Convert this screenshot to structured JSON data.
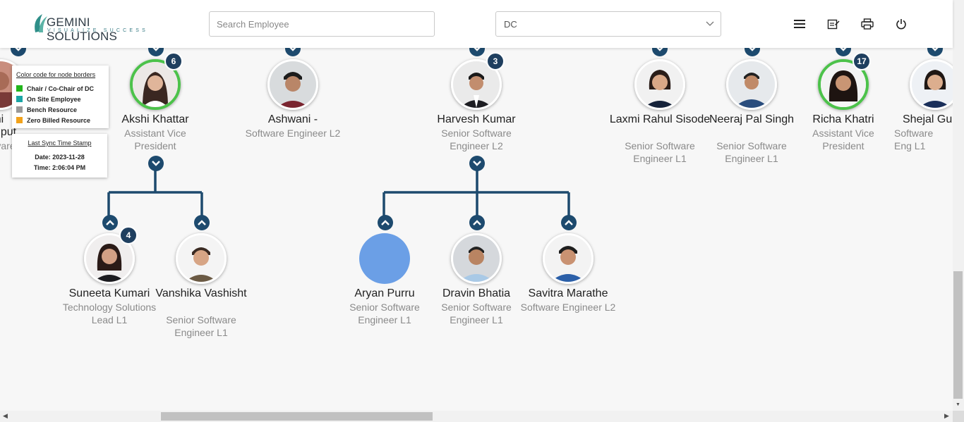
{
  "header": {
    "logo_name": "GEMINI SOLUTIONS",
    "logo_tagline": "VISUALIZE SUCCESS",
    "search_placeholder": "Search Employee",
    "select_value": "DC",
    "icons": [
      "menu-icon",
      "notes-icon",
      "print-icon",
      "power-icon"
    ]
  },
  "legend": {
    "title": "Color code for node borders",
    "items": [
      {
        "label": "Chair / Co-Chair of DC",
        "color": "#22b51c"
      },
      {
        "label": "On Site Employee",
        "color": "#1aa5a5"
      },
      {
        "label": "Bench Resource",
        "color": "#999999"
      },
      {
        "label": "Zero Billed Resource",
        "color": "#f2a21b"
      }
    ]
  },
  "sync": {
    "title": "Last Sync Time Stamp",
    "date": "Date: 2023-11-28",
    "time": "Time: 2:06:04 PM"
  },
  "partial_node": {
    "name_line1": "khi",
    "name_line2": "Rajput",
    "role": "vare"
  },
  "top_row": [
    {
      "name": "Akshi Khattar",
      "role": "Assistant Vice President",
      "badge": "6",
      "chair": true
    },
    {
      "name": "Ashwani -",
      "role": "Software Engineer L2",
      "badge": null,
      "chair": false
    },
    {
      "name": "Harvesh Kumar",
      "role": "Senior Software Engineer L2",
      "badge": "3",
      "chair": false
    },
    {
      "name": "Laxmi Rahul Sisode",
      "role": "Senior Software Engineer L1",
      "badge": null,
      "chair": false
    },
    {
      "name": "Neeraj Pal Singh",
      "role": "Senior Software Engineer L1",
      "badge": null,
      "chair": false
    },
    {
      "name": "Richa Khatri",
      "role": "Assistant Vice President",
      "badge": "17",
      "chair": true
    },
    {
      "name": "Shejal Gu",
      "role": "Software Eng L1",
      "badge": null,
      "chair": false
    }
  ],
  "children_akshi": [
    {
      "name": "Suneeta Kumari",
      "role": "Technology Solutions Lead L1",
      "badge": "4"
    },
    {
      "name": "Vanshika Vashisht",
      "role": "Senior Software Engineer L1",
      "badge": null
    }
  ],
  "children_harvesh": [
    {
      "name": "Aryan Purru",
      "role": "Senior Software Engineer L1",
      "badge": null,
      "placeholder_color": "#6b9fe6"
    },
    {
      "name": "Dravin Bhatia",
      "role": "Senior Software Engineer L1",
      "badge": null
    },
    {
      "name": "Savitra Marathe",
      "role": "Software Engineer L2",
      "badge": null
    }
  ]
}
